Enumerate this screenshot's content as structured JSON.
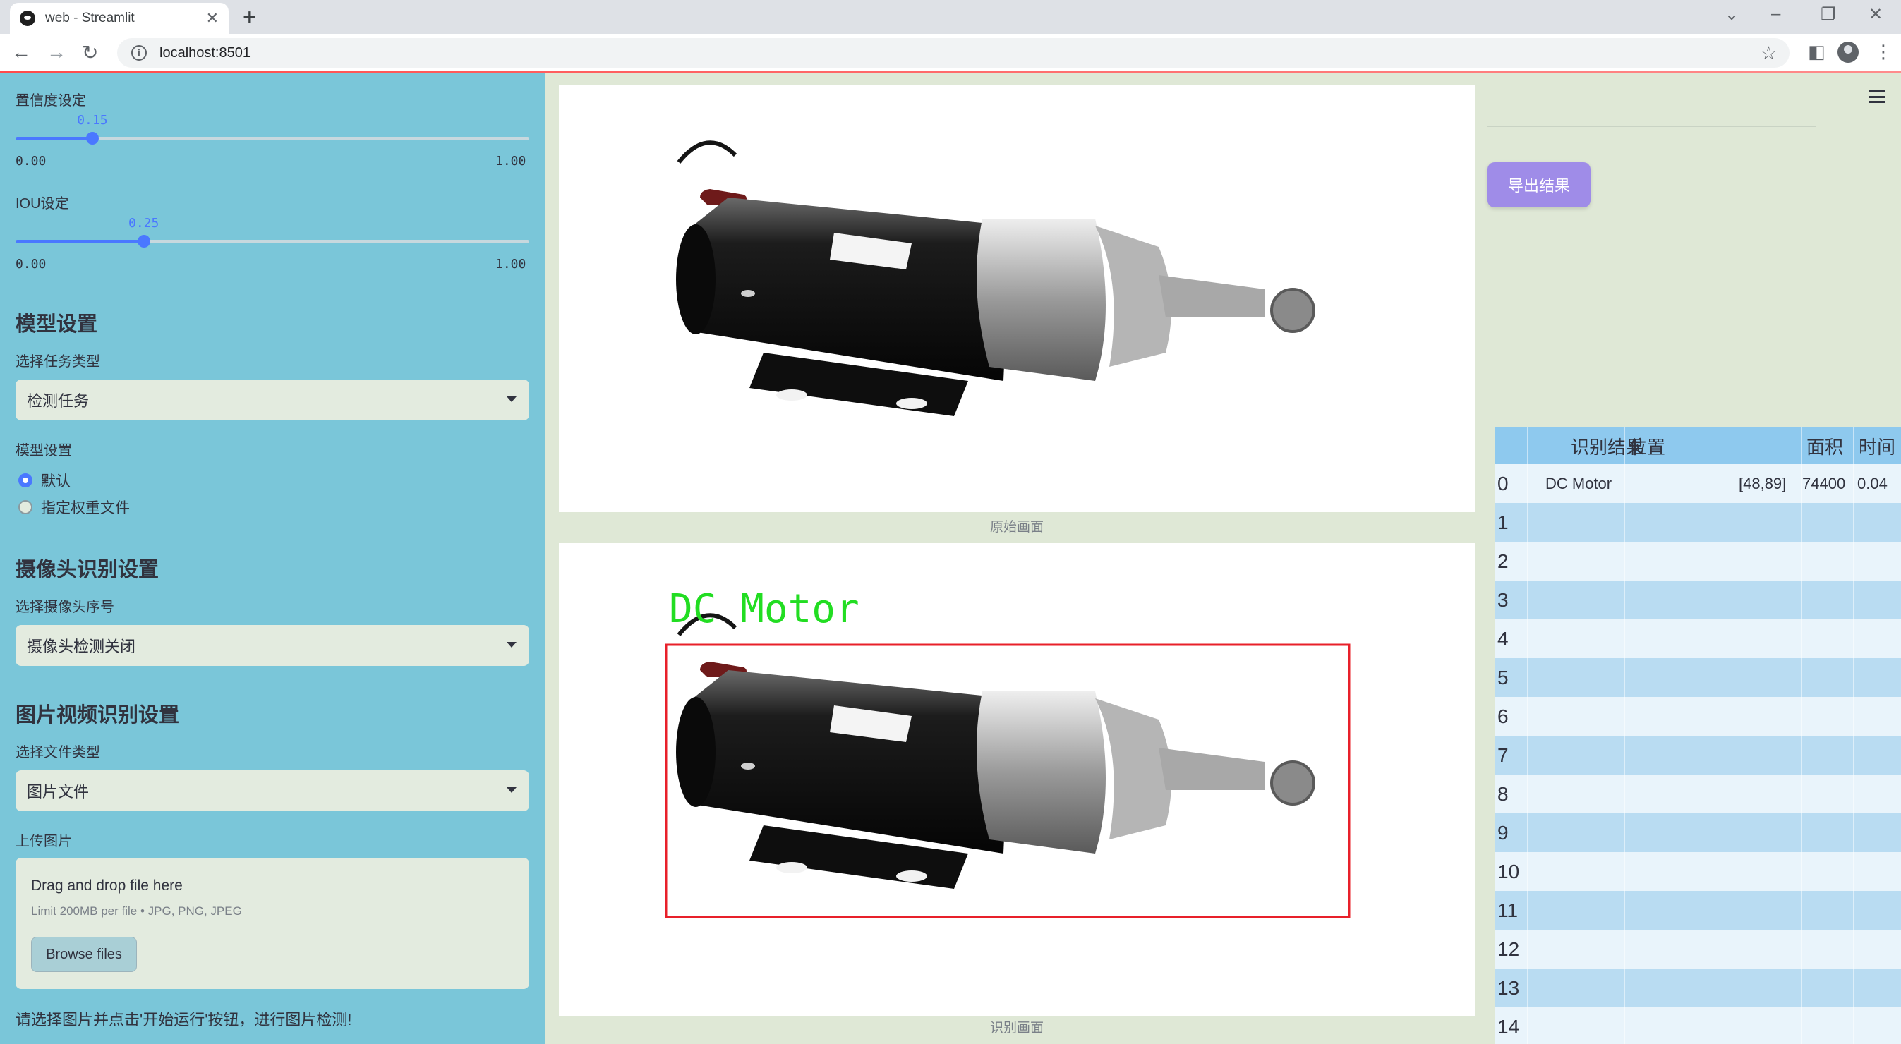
{
  "browser": {
    "tab_title": "web - Streamlit",
    "url": "localhost:8501"
  },
  "sidebar": {
    "confidence": {
      "label": "置信度设定",
      "value": "0.15",
      "fraction": 0.15,
      "min": "0.00",
      "max": "1.00"
    },
    "iou": {
      "label": "IOU设定",
      "value": "0.25",
      "fraction": 0.25,
      "min": "0.00",
      "max": "1.00"
    },
    "model_section": "模型设置",
    "task_type_label": "选择任务类型",
    "task_type_value": "检测任务",
    "model_settings_label": "模型设置",
    "model_options": [
      "默认",
      "指定权重文件"
    ],
    "model_selected": "默认",
    "camera_section": "摄像头识别设置",
    "camera_label": "选择摄像头序号",
    "camera_value": "摄像头检测关闭",
    "media_section": "图片视频识别设置",
    "file_type_label": "选择文件类型",
    "file_type_value": "图片文件",
    "upload_label": "上传图片",
    "uploader": {
      "drop_text": "Drag and drop file here",
      "limit_text": "Limit 200MB per file • JPG, PNG, JPEG",
      "browse_label": "Browse files"
    },
    "hint": "请选择图片并点击'开始运行'按钮，进行图片检测!"
  },
  "main": {
    "original_caption": "原始画面",
    "result_caption": "识别画面",
    "detection_label": "DC  Motor"
  },
  "right": {
    "export_label": "导出结果",
    "table": {
      "columns": [
        "识别结果",
        "位置",
        "面积",
        "时间"
      ],
      "index": [
        "0",
        "1",
        "2",
        "3",
        "4",
        "5",
        "6",
        "7",
        "8",
        "9",
        "10",
        "11",
        "12",
        "13",
        "14"
      ],
      "rows": [
        [
          "DC Motor",
          "[48,89]",
          "74400",
          "0.04"
        ]
      ]
    }
  },
  "colors": {
    "sidebar_bg": "#7ac6d9",
    "accent": "#4a78ff",
    "export_button": "#9f8ce8",
    "detection_box": "#e8202a",
    "detection_text": "#22dd22"
  }
}
